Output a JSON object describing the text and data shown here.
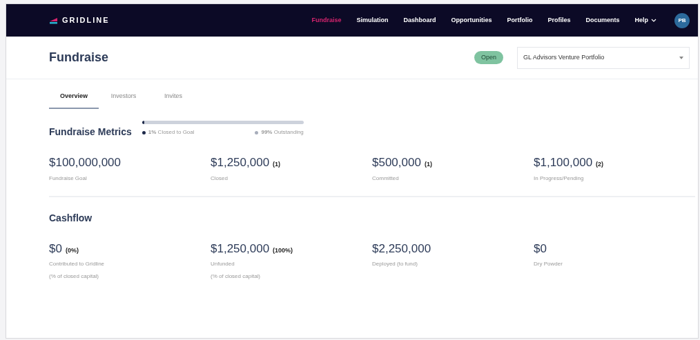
{
  "brand": "GRIDLINE",
  "nav": [
    {
      "label": "Fundraise",
      "selected": true
    },
    {
      "label": "Simulation",
      "selected": false
    },
    {
      "label": "Dashboard",
      "selected": false
    },
    {
      "label": "Opportunities",
      "selected": false
    },
    {
      "label": "Portfolio",
      "selected": false
    },
    {
      "label": "Profiles",
      "selected": false
    },
    {
      "label": "Documents",
      "selected": false
    },
    {
      "label": "Help",
      "selected": false,
      "dropdown": true
    }
  ],
  "avatar": "PB",
  "page_title": "Fundraise",
  "status_badge": "Open",
  "portfolio_select": {
    "value": "GL Advisors Venture Portfolio"
  },
  "tabs": [
    {
      "label": "Overview",
      "selected": true
    },
    {
      "label": "Investors",
      "selected": false
    },
    {
      "label": "Invites",
      "selected": false
    }
  ],
  "metrics": {
    "title": "Fundraise Metrics",
    "progress": {
      "level": 0.01
    },
    "legend": [
      {
        "text": "**1%** Closed to Goal",
        "color": "#1e2a4a"
      },
      {
        "text": "**99%** Outstanding",
        "color": "#a7adbb"
      }
    ],
    "items": [
      {
        "value": "$100,000,000",
        "label": [
          "Fundraise Goal"
        ]
      },
      {
        "value": "$1,250,000",
        "count": "(1)",
        "label": [
          "Closed"
        ]
      },
      {
        "value": "$500,000",
        "count": "(1)",
        "label": [
          "Committed"
        ]
      },
      {
        "value": "$1,100,000",
        "count": "(2)",
        "label": [
          "In Progress/Pending"
        ]
      }
    ]
  },
  "cashflow": {
    "title": "Cashflow",
    "items": [
      {
        "value": "$0",
        "count": "(0%)",
        "label": [
          "Contributed to Gridline",
          "(% of closed capital)"
        ]
      },
      {
        "value": "$1,250,000",
        "count": "(100%)",
        "label": [
          "Unfunded",
          "(% of closed capital)"
        ]
      },
      {
        "value": "$2,250,000",
        "label": [
          "Deployed (to fund)"
        ]
      },
      {
        "value": "$0",
        "label": [
          "Dry Powder"
        ]
      }
    ]
  }
}
